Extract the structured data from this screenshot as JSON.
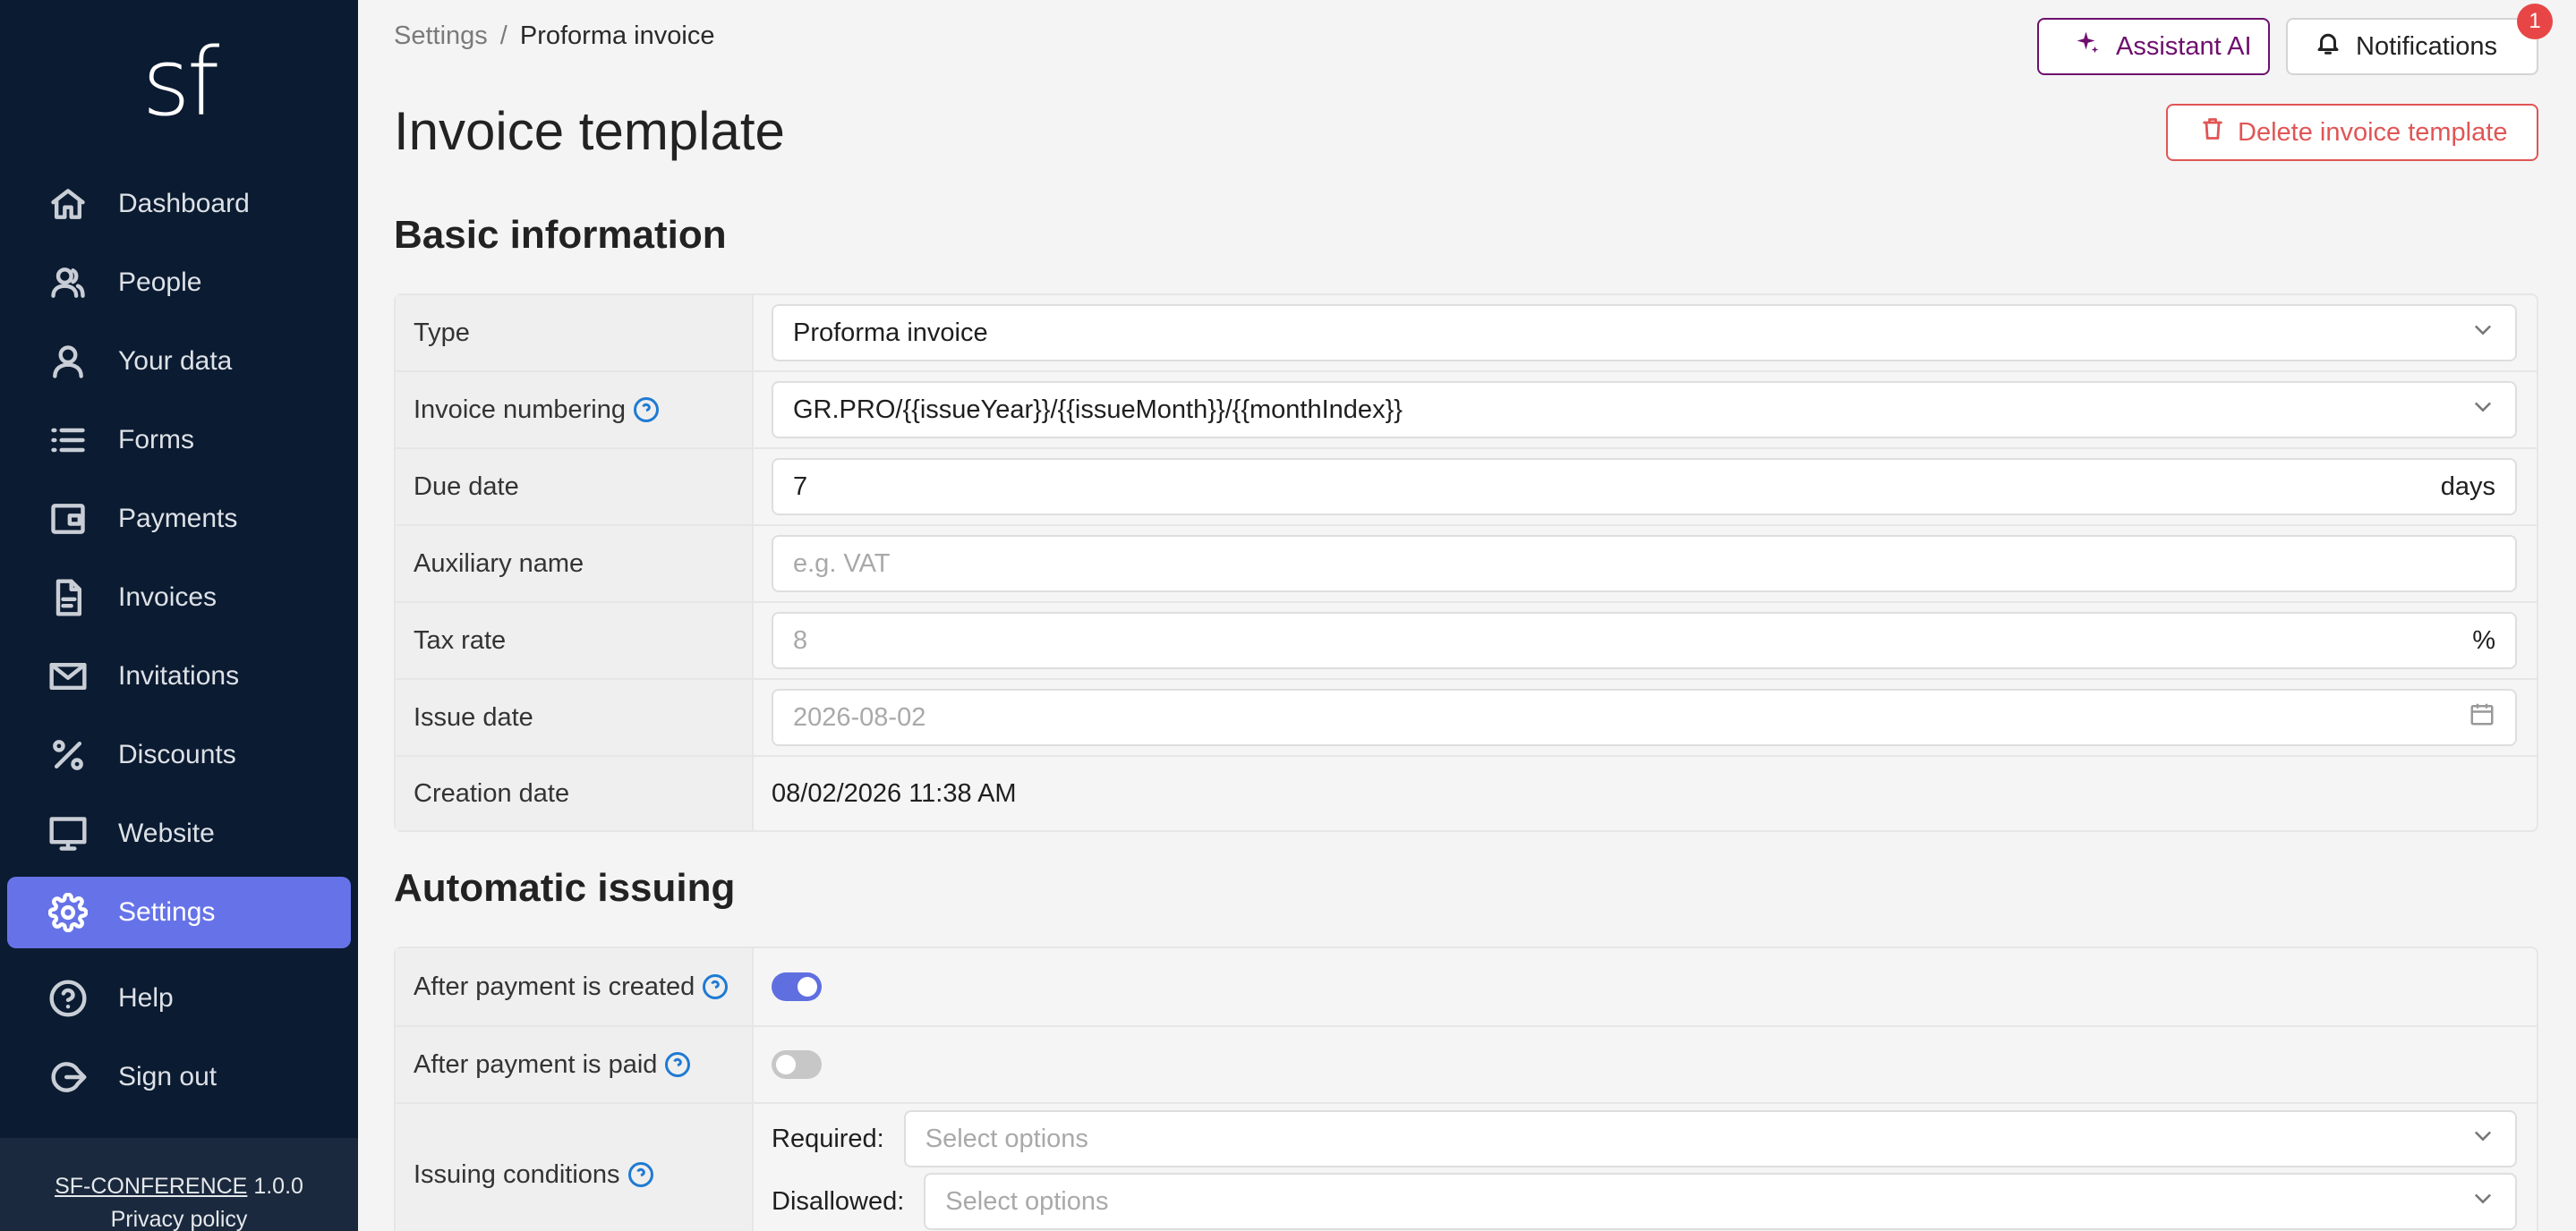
{
  "sidebar": {
    "logo": "sf",
    "items": [
      {
        "label": "Dashboard",
        "icon": "home-icon"
      },
      {
        "label": "People",
        "icon": "people-icon"
      },
      {
        "label": "Your data",
        "icon": "user-icon"
      },
      {
        "label": "Forms",
        "icon": "list-icon"
      },
      {
        "label": "Payments",
        "icon": "wallet-icon"
      },
      {
        "label": "Invoices",
        "icon": "document-icon"
      },
      {
        "label": "Invitations",
        "icon": "mail-icon"
      },
      {
        "label": "Discounts",
        "icon": "percent-icon"
      },
      {
        "label": "Website",
        "icon": "monitor-icon"
      },
      {
        "label": "Settings",
        "icon": "gear-icon",
        "active": true
      },
      {
        "label": "Help",
        "icon": "help-circle-icon"
      },
      {
        "label": "Sign out",
        "icon": "sign-out-icon"
      }
    ],
    "footer": {
      "app_link": "SF-CONFERENCE",
      "version": "1.0.0",
      "privacy": "Privacy policy"
    }
  },
  "header": {
    "breadcrumb": [
      "Settings",
      "Proforma invoice"
    ],
    "breadcrumb_sep": "/",
    "assistant_label": "Assistant AI",
    "notifications_label": "Notifications",
    "notifications_count": "1",
    "title": "Invoice template",
    "delete_label": "Delete invoice template"
  },
  "basic": {
    "title": "Basic information",
    "type_label": "Type",
    "type_value": "Proforma invoice",
    "numbering_label": "Invoice numbering",
    "numbering_value": "GR.PRO/{{issueYear}}/{{issueMonth}}/{{monthIndex}}",
    "due_label": "Due date",
    "due_value": "7",
    "due_suffix": "days",
    "aux_label": "Auxiliary name",
    "aux_placeholder": "e.g. VAT",
    "tax_label": "Tax rate",
    "tax_placeholder": "8",
    "tax_suffix": "%",
    "issue_label": "Issue date",
    "issue_placeholder": "2026-08-02",
    "creation_label": "Creation date",
    "creation_value": "08/02/2026 11:38 AM"
  },
  "auto": {
    "title": "Automatic issuing",
    "after_created_label": "After payment is created",
    "after_created_on": true,
    "after_paid_label": "After payment is paid",
    "after_paid_on": false,
    "conditions_label": "Issuing conditions",
    "required_label": "Required:",
    "required_placeholder": "Select options",
    "disallowed_label": "Disallowed:",
    "disallowed_placeholder": "Select options"
  },
  "colors": {
    "sidebar_bg": "#0b1b31",
    "active_item": "#6673e8",
    "assistant_accent": "#6e0f6e",
    "danger": "#e05555",
    "toggle_on": "#5f6fe0",
    "help_icon": "#1f7ad3"
  }
}
